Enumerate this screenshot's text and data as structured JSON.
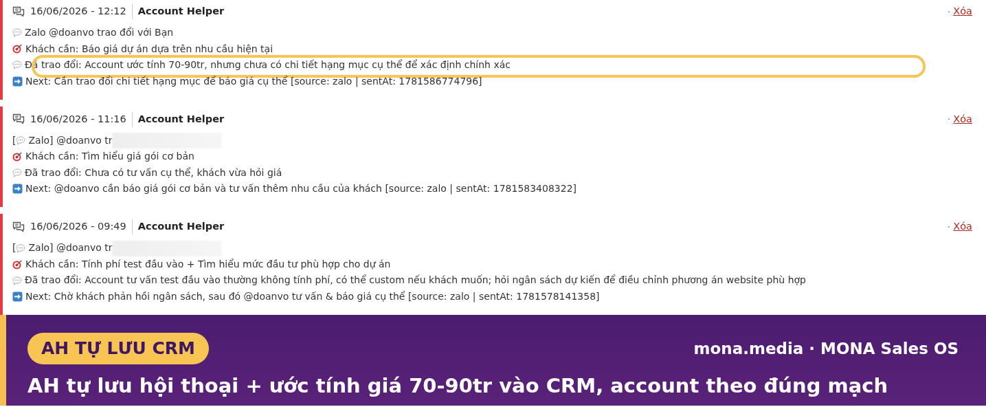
{
  "entries": [
    {
      "timestamp": "16/06/2026 - 12:12",
      "author": "Account Helper",
      "bullet": "·",
      "delete_label": "Xóa",
      "lines": [
        {
          "kind": "chat",
          "text": "Zalo @doanvo trao đổi với Bạn",
          "redacted": false,
          "highlighted": false
        },
        {
          "kind": "target",
          "text": "Khách cần: Báo giá dự án dựa trên nhu cầu hiện tại",
          "redacted": false,
          "highlighted": false
        },
        {
          "kind": "chat",
          "text": "Đã trao đổi: Account ước tính 70-90tr, nhưng chưa có chi tiết hạng mục cụ thể để xác định chính xác",
          "redacted": false,
          "highlighted": true
        },
        {
          "kind": "arrow",
          "text": "Next: Cần trao đổi chi tiết hạng mục để báo giá cụ thể [source: zalo | sentAt: 1781586774796]",
          "redacted": false,
          "highlighted": false
        }
      ]
    },
    {
      "timestamp": "16/06/2026 - 11:16",
      "author": "Account Helper",
      "bullet": "·",
      "delete_label": "Xóa",
      "lines": [
        {
          "kind": "chat",
          "before": "[",
          "text": "Zalo] @doanvo tr",
          "redacted": true,
          "highlighted": false
        },
        {
          "kind": "target",
          "text": "Khách cần: Tìm hiểu giá gói cơ bản",
          "redacted": false,
          "highlighted": false
        },
        {
          "kind": "chat",
          "text": "Đã trao đổi: Chưa có tư vấn cụ thể, khách vừa hỏi giá",
          "redacted": false,
          "highlighted": false
        },
        {
          "kind": "arrow",
          "text": "Next: @doanvo cần báo giá gói cơ bản và tư vấn thêm nhu cầu của khách [source: zalo | sentAt: 1781583408322]",
          "redacted": false,
          "highlighted": false
        }
      ]
    },
    {
      "timestamp": "16/06/2026 - 09:49",
      "author": "Account Helper",
      "bullet": "·",
      "delete_label": "Xóa",
      "lines": [
        {
          "kind": "chat",
          "before": "[",
          "text": "Zalo] @doanvo tr",
          "redacted": true,
          "highlighted": false
        },
        {
          "kind": "target",
          "text": "Khách cần: Tính phí test đầu vào + Tìm hiểu mức đầu tư phù hợp cho dự án",
          "redacted": false,
          "highlighted": false
        },
        {
          "kind": "chat",
          "text": "Đã trao đổi: Account tư vấn test đầu vào thường không tính phí, có thể custom nếu khách muốn; hỏi ngân sách dự kiến để điều chỉnh phương án website phù hợp",
          "redacted": false,
          "highlighted": false
        },
        {
          "kind": "arrow",
          "text": "Next: Chờ khách phản hồi ngân sách, sau đó @doanvo tư vấn & báo giá cụ thể [source: zalo | sentAt: 1781578141358]",
          "redacted": false,
          "highlighted": false
        }
      ]
    }
  ],
  "banner": {
    "tag": "AH TỰ LƯU CRM",
    "brand": "mona.media · MONA Sales OS",
    "headline": "AH tự lưu hội thoại + ước tính giá 70-90tr vào CRM, account theo đúng mạch"
  }
}
